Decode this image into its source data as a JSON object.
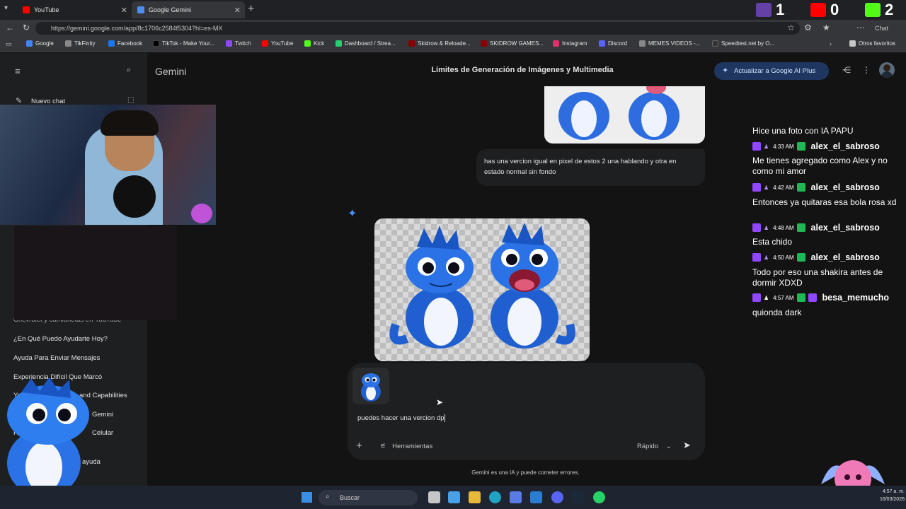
{
  "browser": {
    "tabs": [
      {
        "label": "YouTube",
        "active": false
      },
      {
        "label": "Google Gemini",
        "active": true
      }
    ],
    "url": "https://gemini.google.com/app/8c1706c2584f5304?hl=es-MX",
    "bookmarks": [
      "Google",
      "TikFinity",
      "Facebook",
      "TikTok - Make Your...",
      "Twitch",
      "YouTube",
      "Kick",
      "Dashboard / Strea...",
      "Skidrow & Reloade...",
      "SKIDROW GAMES...",
      "Instagram",
      "Discord",
      "MEMES VIDEOS -...",
      "Speedtest.net by O..."
    ],
    "other_bookmarks": "Otros favoritos",
    "chat_button": "Chat"
  },
  "stream_counters": [
    {
      "platform": "twitch-icon",
      "value": "1"
    },
    {
      "platform": "youtube-icon",
      "value": "0"
    },
    {
      "platform": "kick-icon",
      "value": "2"
    }
  ],
  "gemini": {
    "brand": "Gemini",
    "conversation_title": "Límites de Generación de Imágenes y Multimedia",
    "upgrade_label": "Actualizar a Google AI Plus",
    "sidebar": {
      "new_chat": "Nuevo chat",
      "items": [
        "Chevrolet y camionetas en YouTube",
        "¿En Qué Puedo Ayudarte Hoy?",
        "Ayuda Para Enviar Mensajes",
        "Experiencia Difícil Que Marcó",
        "YouTube",
        "and Capabilities",
        "Gemini",
        "Celular",
        "ayuda"
      ],
      "partial_prefixes": [
        "Ay",
        "Rec"
      ]
    },
    "user_message": "has una vercion igual en pixel de estos 2 una hablando y otra en estado normal sin fondo",
    "input_text": "puedes hacer una vercion dp",
    "tools_label": "Herramientas",
    "mode_label": "Rápido",
    "disclaimer": "Gemini es una IA y puede cometer errores."
  },
  "stream_chat": [
    {
      "time": "",
      "user": "",
      "message": "Hice una foto con IA PAPU"
    },
    {
      "time": "4:33 AM",
      "user": "alex_el_sabroso",
      "message": "Me tienes agregado como Alex y no como mi amor"
    },
    {
      "time": "4:42 AM",
      "user": "alex_el_sabroso",
      "message": "Entonces ya quitaras esa bola rosa xd"
    },
    {
      "time": "4:48 AM",
      "user": "alex_el_sabroso",
      "message": "Esta chido"
    },
    {
      "time": "4:50 AM",
      "user": "alex_el_sabroso",
      "message": "Todo por eso una shakira antes de dormir XDXD"
    },
    {
      "time": "4:57 AM",
      "user": "besa_memucho",
      "message": "quionda dark"
    }
  ],
  "taskbar": {
    "search": "Buscar",
    "clock_time": "4:57 a. m.",
    "clock_date": "16/03/2026"
  },
  "colors": {
    "background": "#131314",
    "sidebar": "#1e1f20",
    "accent": "#1f3760",
    "twitch": "#9146ff"
  }
}
